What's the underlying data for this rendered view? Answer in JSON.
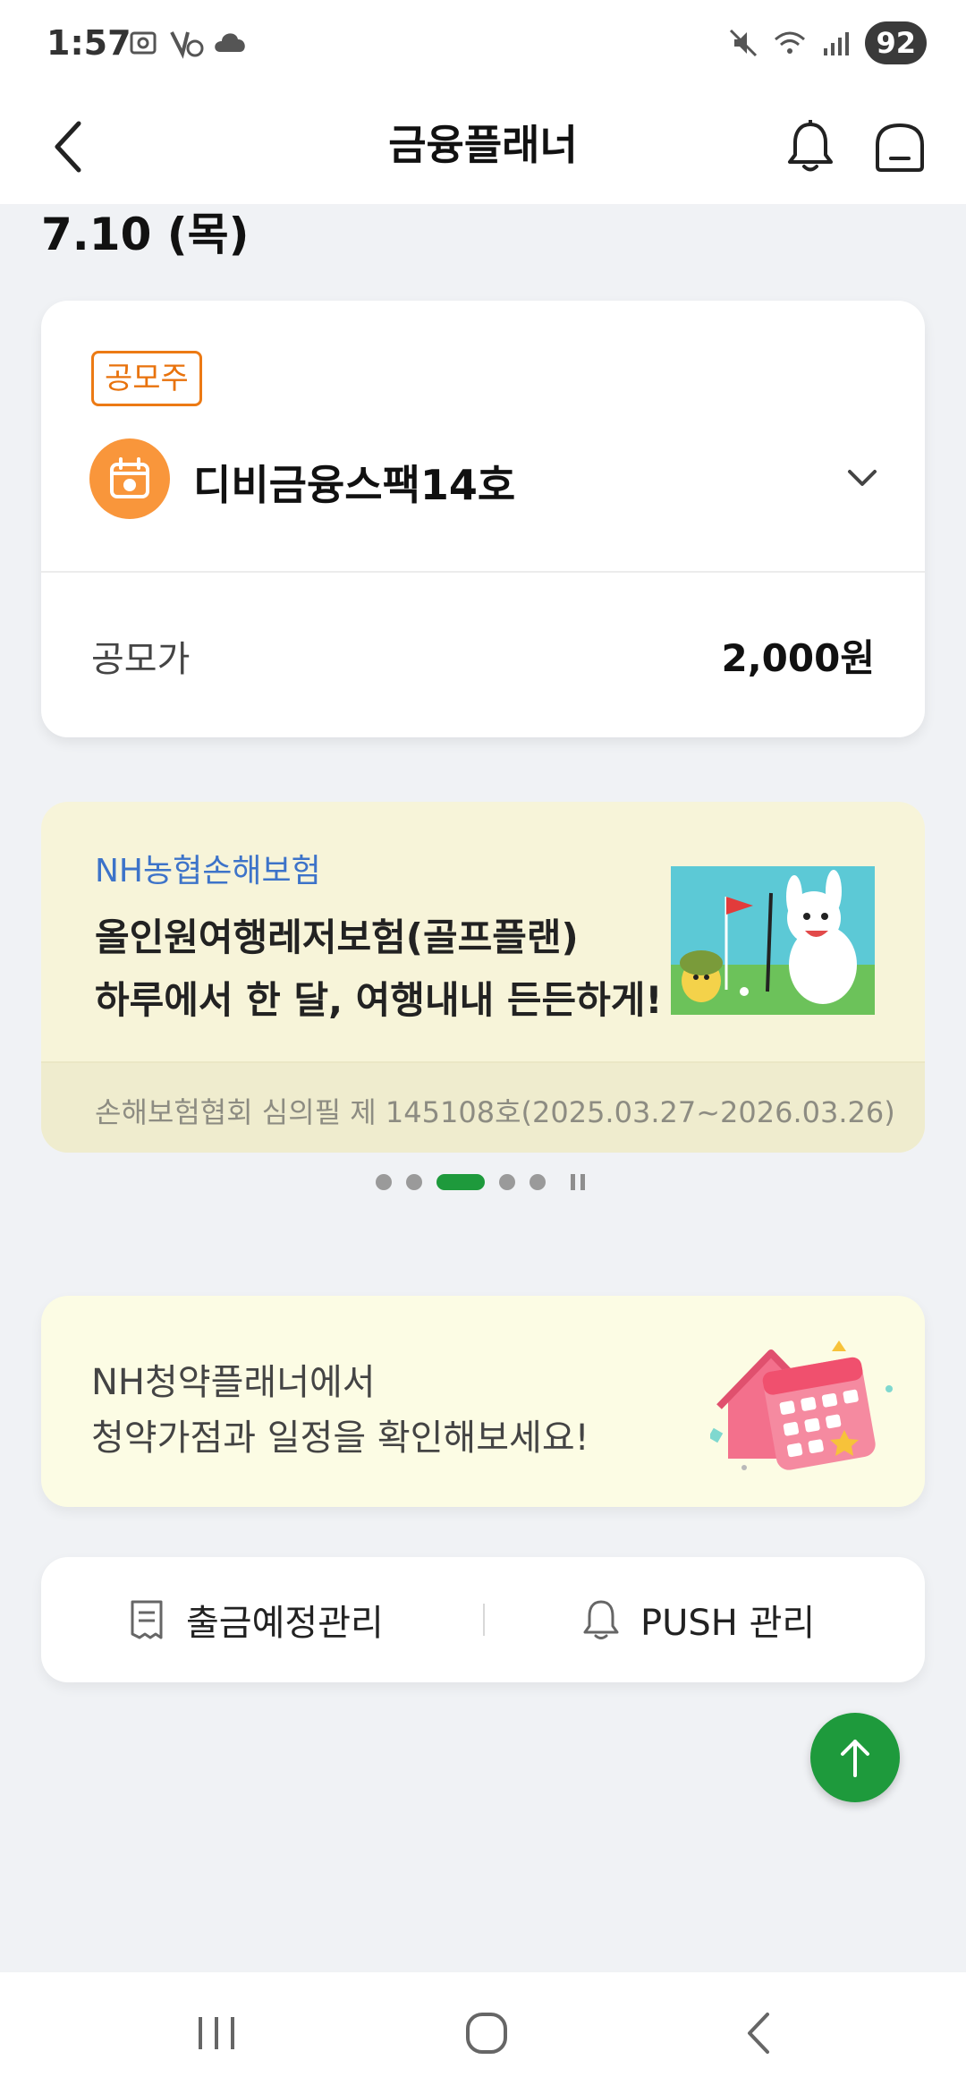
{
  "status_bar": {
    "time": "1:57",
    "battery": "92"
  },
  "header": {
    "title": "금융플래너"
  },
  "schedule": {
    "date": "7.10 (목)"
  },
  "ipo_card": {
    "badge": "공모주",
    "name": "디비금융스팩14호",
    "price_label": "공모가",
    "price_value": "2,000원"
  },
  "ad_banner": {
    "brand": "NH농협손해보험",
    "line1": "올인원여행레저보험(골프플랜)",
    "line2": "하루에서 한 달, 여행내내 든든하게!",
    "disclaimer": "손해보험협회 심의필 제 145108호(2025.03.27~2026.03.26)"
  },
  "carousel": {
    "total": 5,
    "active_index": 2
  },
  "subscription_banner": {
    "line1": "NH청약플래너에서",
    "line2": "청약가점과 일정을 확인해보세요!"
  },
  "actions": {
    "withdraw_label": "출금예정관리",
    "push_label": "PUSH 관리"
  },
  "colors": {
    "accent_green": "#1e9a3c",
    "badge_orange": "#e8720c",
    "brand_blue": "#3d73c9",
    "page_bg": "#f0f2f5"
  },
  "icons": {
    "back": "chevron-left-icon",
    "bell": "bell-icon",
    "home": "home-icon",
    "calendar": "calendar-icon",
    "chevron": "chevron-down-icon",
    "receipt": "receipt-icon",
    "scroll_top": "arrow-up-icon"
  }
}
